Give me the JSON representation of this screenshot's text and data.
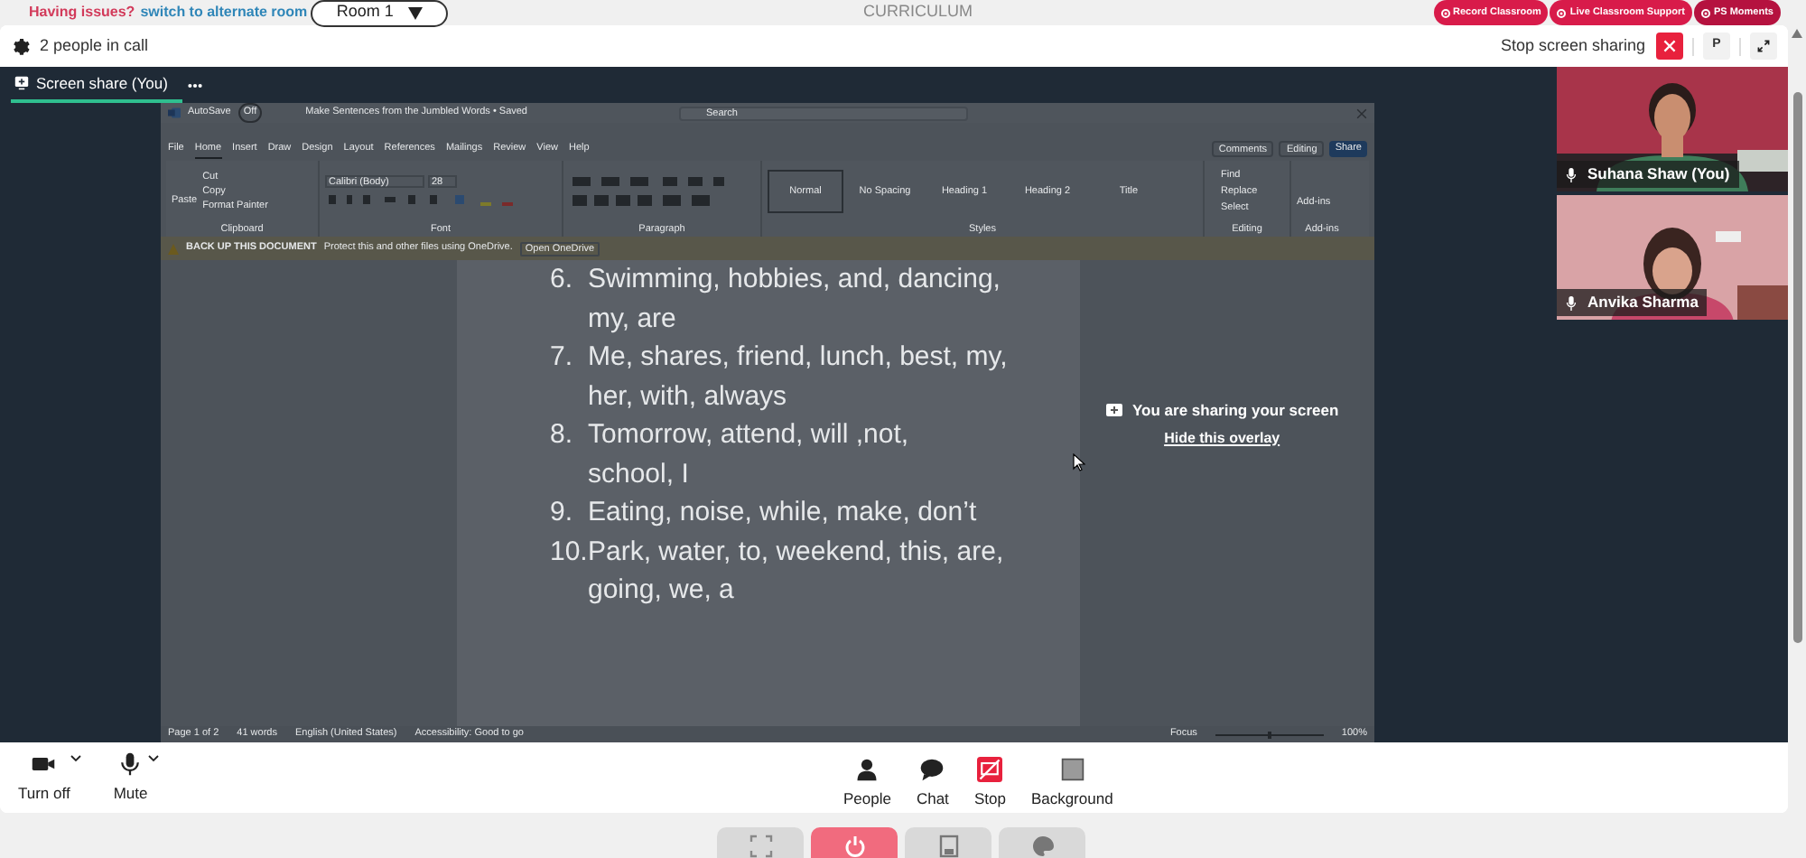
{
  "top_bar": {
    "issue_text": "Having issues?",
    "alternate_link": "switch to alternate room",
    "room_select": "Room 1",
    "title": "CURRICULUM",
    "actions": [
      "Record Classroom",
      "Live Classroom Support",
      "PS Moments"
    ]
  },
  "call_header": {
    "people_count": "2 people in call",
    "stop_label": "Stop screen sharing",
    "participant_initial": "P"
  },
  "stage_tabs": [
    {
      "label": "Screen share (You)",
      "selected": true
    }
  ],
  "shared_screen": {
    "autosave": "AutoSave",
    "autosave_state": "Off",
    "document_title": "Make Sentences from the Jumbled Words • Saved",
    "search_placeholder": "Search",
    "menu": [
      {
        "label": "File",
        "selected": false
      },
      {
        "label": "Home",
        "selected": true
      },
      {
        "label": "Insert",
        "selected": false
      },
      {
        "label": "Draw",
        "selected": false
      },
      {
        "label": "Design",
        "selected": false
      },
      {
        "label": "Layout",
        "selected": false
      },
      {
        "label": "References",
        "selected": false
      },
      {
        "label": "Mailings",
        "selected": false
      },
      {
        "label": "Review",
        "selected": false
      },
      {
        "label": "View",
        "selected": false
      },
      {
        "label": "Help",
        "selected": false
      }
    ],
    "comments": "Comments",
    "editing_mode": "Editing",
    "share": "Share",
    "clipboard": {
      "paste": "Paste",
      "items": [
        "Cut",
        "Copy",
        "Format Painter"
      ],
      "label": "Clipboard"
    },
    "font": {
      "name": "Calibri (Body)",
      "size": "28",
      "label": "Font"
    },
    "paragraph_label": "Paragraph",
    "styles": {
      "items": [
        {
          "label": "Normal",
          "selected": true
        },
        {
          "label": "No Spacing",
          "selected": false
        },
        {
          "label": "Heading 1",
          "selected": false
        },
        {
          "label": "Heading 2",
          "selected": false
        },
        {
          "label": "Title",
          "selected": false
        }
      ],
      "label": "Styles"
    },
    "editing": {
      "items": [
        "Find",
        "Replace",
        "Select"
      ],
      "label": "Editing"
    },
    "addins": {
      "button": "Add-ins",
      "label": "Add-ins"
    },
    "banner": {
      "title": "BACK UP THIS DOCUMENT",
      "text": "Protect this and other files using OneDrive.",
      "button": "Open OneDrive"
    },
    "list_items": [
      {
        "number": "6.",
        "lines": [
          "Swimming, hobbies, and, dancing,",
          "my, are"
        ]
      },
      {
        "number": "7.",
        "lines": [
          "Me, shares, friend, lunch, best, my,",
          "her, with, always"
        ]
      },
      {
        "number": "8.",
        "lines": [
          "Tomorrow, attend, will ,not,",
          "school, I"
        ]
      },
      {
        "number": "9.",
        "lines": [
          "Eating, noise, while, make, don’t"
        ]
      },
      {
        "number": "10.",
        "lines": [
          "Park, water, to, weekend, this, are,",
          "going, we, a"
        ]
      }
    ],
    "status_bar": {
      "left": [
        "Page 1 of 2",
        "41 words",
        "English (United States)",
        "Accessibility: Good to go"
      ],
      "focus": "Focus",
      "zoom": "100%"
    }
  },
  "overlay": {
    "message": "You are sharing your screen",
    "link": "Hide this overlay"
  },
  "participants": [
    {
      "name": "Suhana Shaw (You)",
      "kind": "adult"
    },
    {
      "name": "Anvika Sharma",
      "kind": "child"
    }
  ],
  "controls": {
    "left": [
      {
        "label": "Turn off",
        "kind": "camera"
      },
      {
        "label": "Mute",
        "kind": "mic"
      }
    ],
    "center": [
      {
        "label": "People",
        "kind": "people"
      },
      {
        "label": "Chat",
        "kind": "chat"
      },
      {
        "label": "Stop",
        "kind": "stop"
      },
      {
        "label": "Background",
        "kind": "background"
      }
    ]
  },
  "dock": [
    {
      "kind": "fullscreen"
    },
    {
      "kind": "power"
    },
    {
      "kind": "screen"
    },
    {
      "kind": "palette"
    }
  ]
}
